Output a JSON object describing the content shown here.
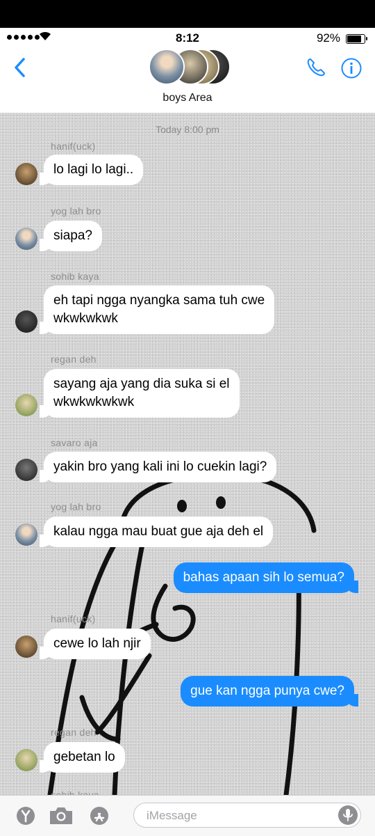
{
  "status": {
    "time": "8:12",
    "battery": "92%",
    "battery_level": 0.92
  },
  "header": {
    "group_name": "boys Area"
  },
  "chat": {
    "timestamp": "Today 8:00 pm",
    "messages": [
      {
        "sender": "hanif(uck)",
        "text": "lo lagi lo lagi.."
      },
      {
        "sender": "yog lah bro",
        "text": "siapa?"
      },
      {
        "sender": "sohib kaya",
        "line1": "eh tapi ngga nyangka sama tuh cwe",
        "line2": "wkwkwkwk"
      },
      {
        "sender": "regan deh",
        "line1": "sayang aja yang dia suka si el",
        "line2": "wkwkwkwkwk"
      },
      {
        "sender": "savaro aja",
        "text": "yakin bro yang kali ini lo cuekin lagi?"
      },
      {
        "sender": "yog lah bro",
        "text": "kalau ngga mau buat gue aja deh el"
      },
      {
        "me": true,
        "text": "bahas apaan sih lo semua?"
      },
      {
        "sender": "hanif(uck)",
        "text": "cewe lo lah njir"
      },
      {
        "me": true,
        "text": "gue kan ngga punya cwe?"
      },
      {
        "sender": "regan deh",
        "text": "gebetan lo"
      },
      {
        "sender": "sohib kaya"
      }
    ]
  },
  "composer": {
    "placeholder": "iMessage"
  },
  "colors": {
    "accent": "#1a8cff",
    "bubble_in": "#ffffff",
    "chat_bg": "#d2d2d2"
  },
  "icons": [
    "back-chevron-icon",
    "phone-icon",
    "info-icon",
    "apps-icon",
    "camera-icon",
    "app-store-icon",
    "microphone-icon"
  ]
}
